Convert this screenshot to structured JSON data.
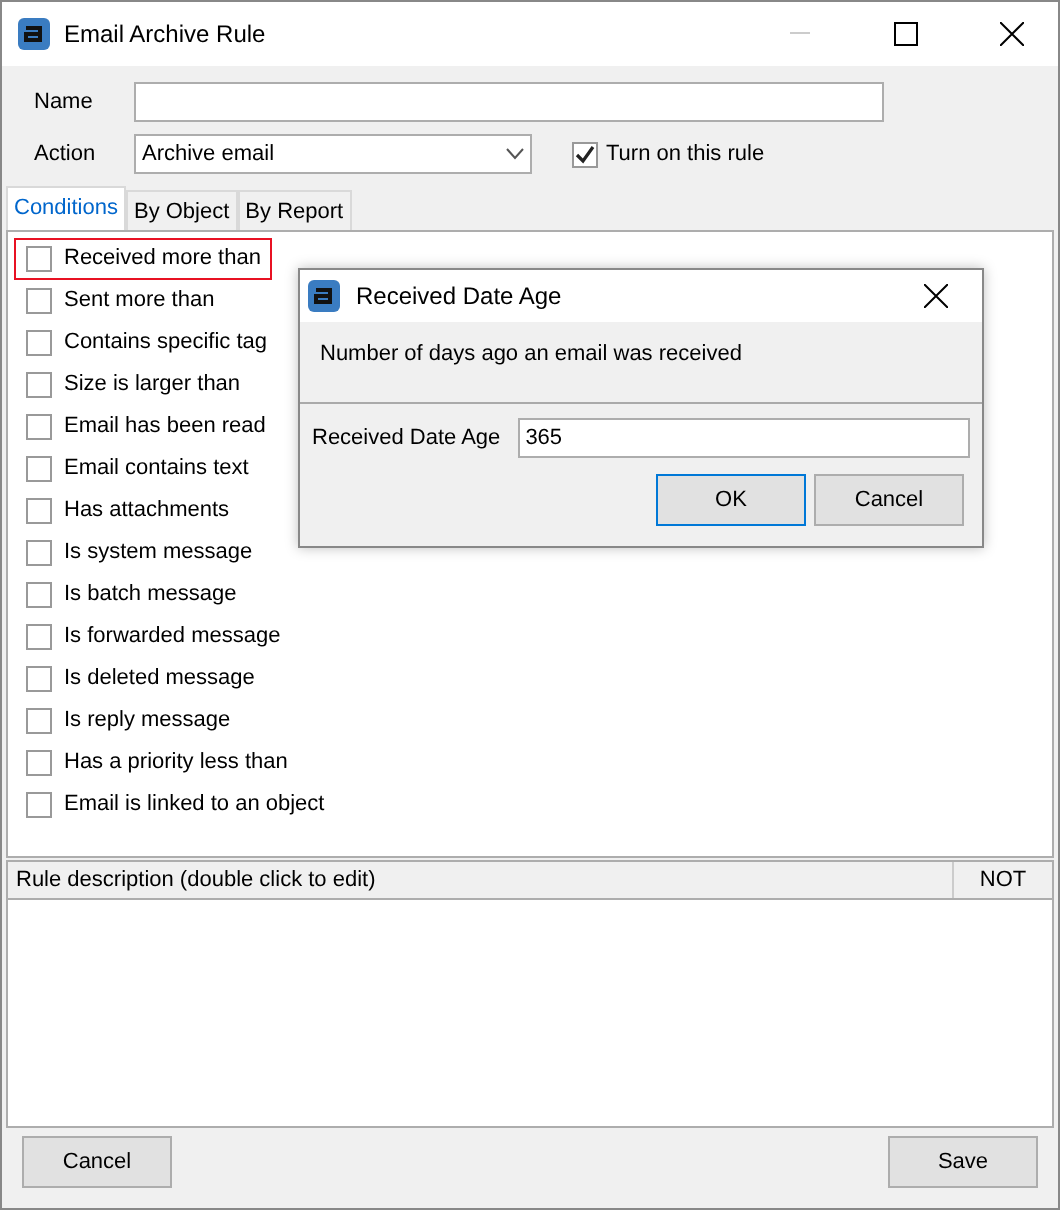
{
  "window": {
    "title": "Email Archive Rule"
  },
  "form": {
    "name_label": "Name",
    "action_label": "Action",
    "action_value": "Archive email",
    "enable": {
      "label": "Turn on this rule",
      "checked": true
    }
  },
  "tabs": [
    {
      "label": "Conditions",
      "selected": true
    },
    {
      "label": "By Object",
      "selected": false
    },
    {
      "label": "By Report",
      "selected": false
    }
  ],
  "conditions": [
    {
      "label": "Received more than",
      "checked": false,
      "selected": true
    },
    {
      "label": "Sent more than",
      "checked": false,
      "selected": false
    },
    {
      "label": "Contains specific tag",
      "checked": false,
      "selected": false
    },
    {
      "label": "Size is larger than",
      "checked": false,
      "selected": false
    },
    {
      "label": "Email has been read",
      "checked": false,
      "selected": false
    },
    {
      "label": "Email contains text",
      "checked": false,
      "selected": false
    },
    {
      "label": "Has attachments",
      "checked": false,
      "selected": false
    },
    {
      "label": "Is system message",
      "checked": false,
      "selected": false
    },
    {
      "label": "Is batch message",
      "checked": false,
      "selected": false
    },
    {
      "label": "Is forwarded message",
      "checked": false,
      "selected": false
    },
    {
      "label": "Is deleted message",
      "checked": false,
      "selected": false
    },
    {
      "label": "Is reply message",
      "checked": false,
      "selected": false
    },
    {
      "label": "Has a priority less than",
      "checked": false,
      "selected": false
    },
    {
      "label": "Email is linked to an object",
      "checked": false,
      "selected": false
    }
  ],
  "description": {
    "header": "Rule description (double click to edit)",
    "not_label": "NOT"
  },
  "buttons": {
    "cancel": "Cancel",
    "save": "Save"
  },
  "dialog": {
    "title": "Received Date Age",
    "message": "Number of days ago an email was received",
    "field_label": "Received Date Age",
    "field_value": "365",
    "ok": "OK",
    "cancel": "Cancel"
  }
}
